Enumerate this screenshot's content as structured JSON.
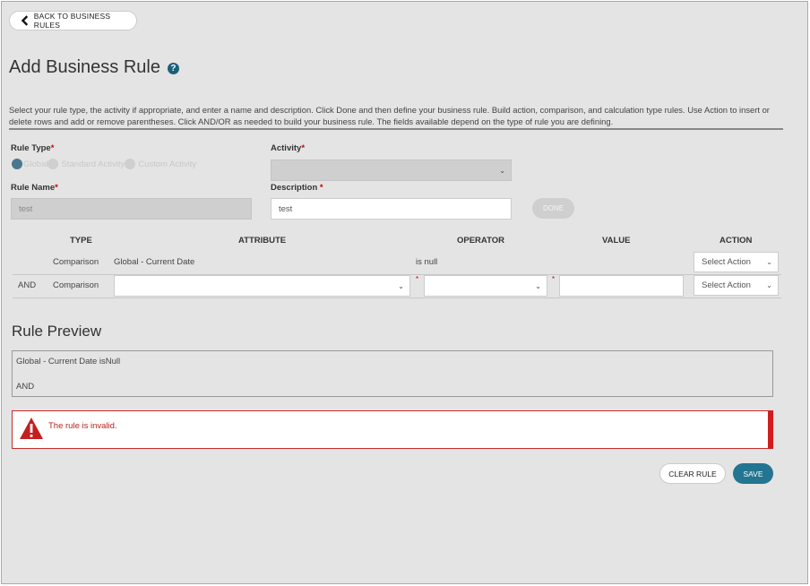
{
  "nav": {
    "back_label": "BACK TO BUSINESS RULES"
  },
  "page": {
    "title": "Add Business Rule",
    "help_glyph": "?",
    "intro": "Select your rule type, the activity if appropriate, and enter a name and description. Click Done and then define your business rule. Build action, comparison, and calculation type rules. Use Action to insert or delete rows and add or remove parentheses. Click AND/OR as needed to build your business rule. The fields available depend on the type of rule you are defining."
  },
  "form": {
    "rule_type_label": "Rule Type",
    "required_mark": "*",
    "rule_types": [
      {
        "label": "Global",
        "selected": true
      },
      {
        "label": "Standard Activity",
        "selected": false
      },
      {
        "label": "Custom Activity",
        "selected": false
      }
    ],
    "activity_label": "Activity",
    "activity_value": "",
    "rule_name_label": "Rule Name",
    "rule_name_value": "test",
    "description_label": "Description ",
    "description_value": "test",
    "done_label": "DONE"
  },
  "table": {
    "headers": [
      "TYPE",
      "ATTRIBUTE",
      "OPERATOR",
      "VALUE",
      "ACTION"
    ],
    "rows": [
      {
        "connector": "",
        "type": "Comparison",
        "attribute": "Global - Current Date",
        "operator": "is null",
        "value": "",
        "action": "Select Action"
      },
      {
        "connector": "AND",
        "type": "Comparison",
        "attribute": "",
        "operator": "",
        "value": "",
        "action": "Select Action"
      }
    ]
  },
  "preview": {
    "title": "Rule Preview",
    "line1": "Global - Current Date isNull",
    "line2": "AND"
  },
  "error": {
    "message": "The rule is invalid."
  },
  "buttons": {
    "clear_label": "CLEAR RULE",
    "save_label": "SAVE"
  },
  "colors": {
    "accent": "#237591",
    "error": "#d21d1d",
    "radio_selected": "#4a7790"
  }
}
